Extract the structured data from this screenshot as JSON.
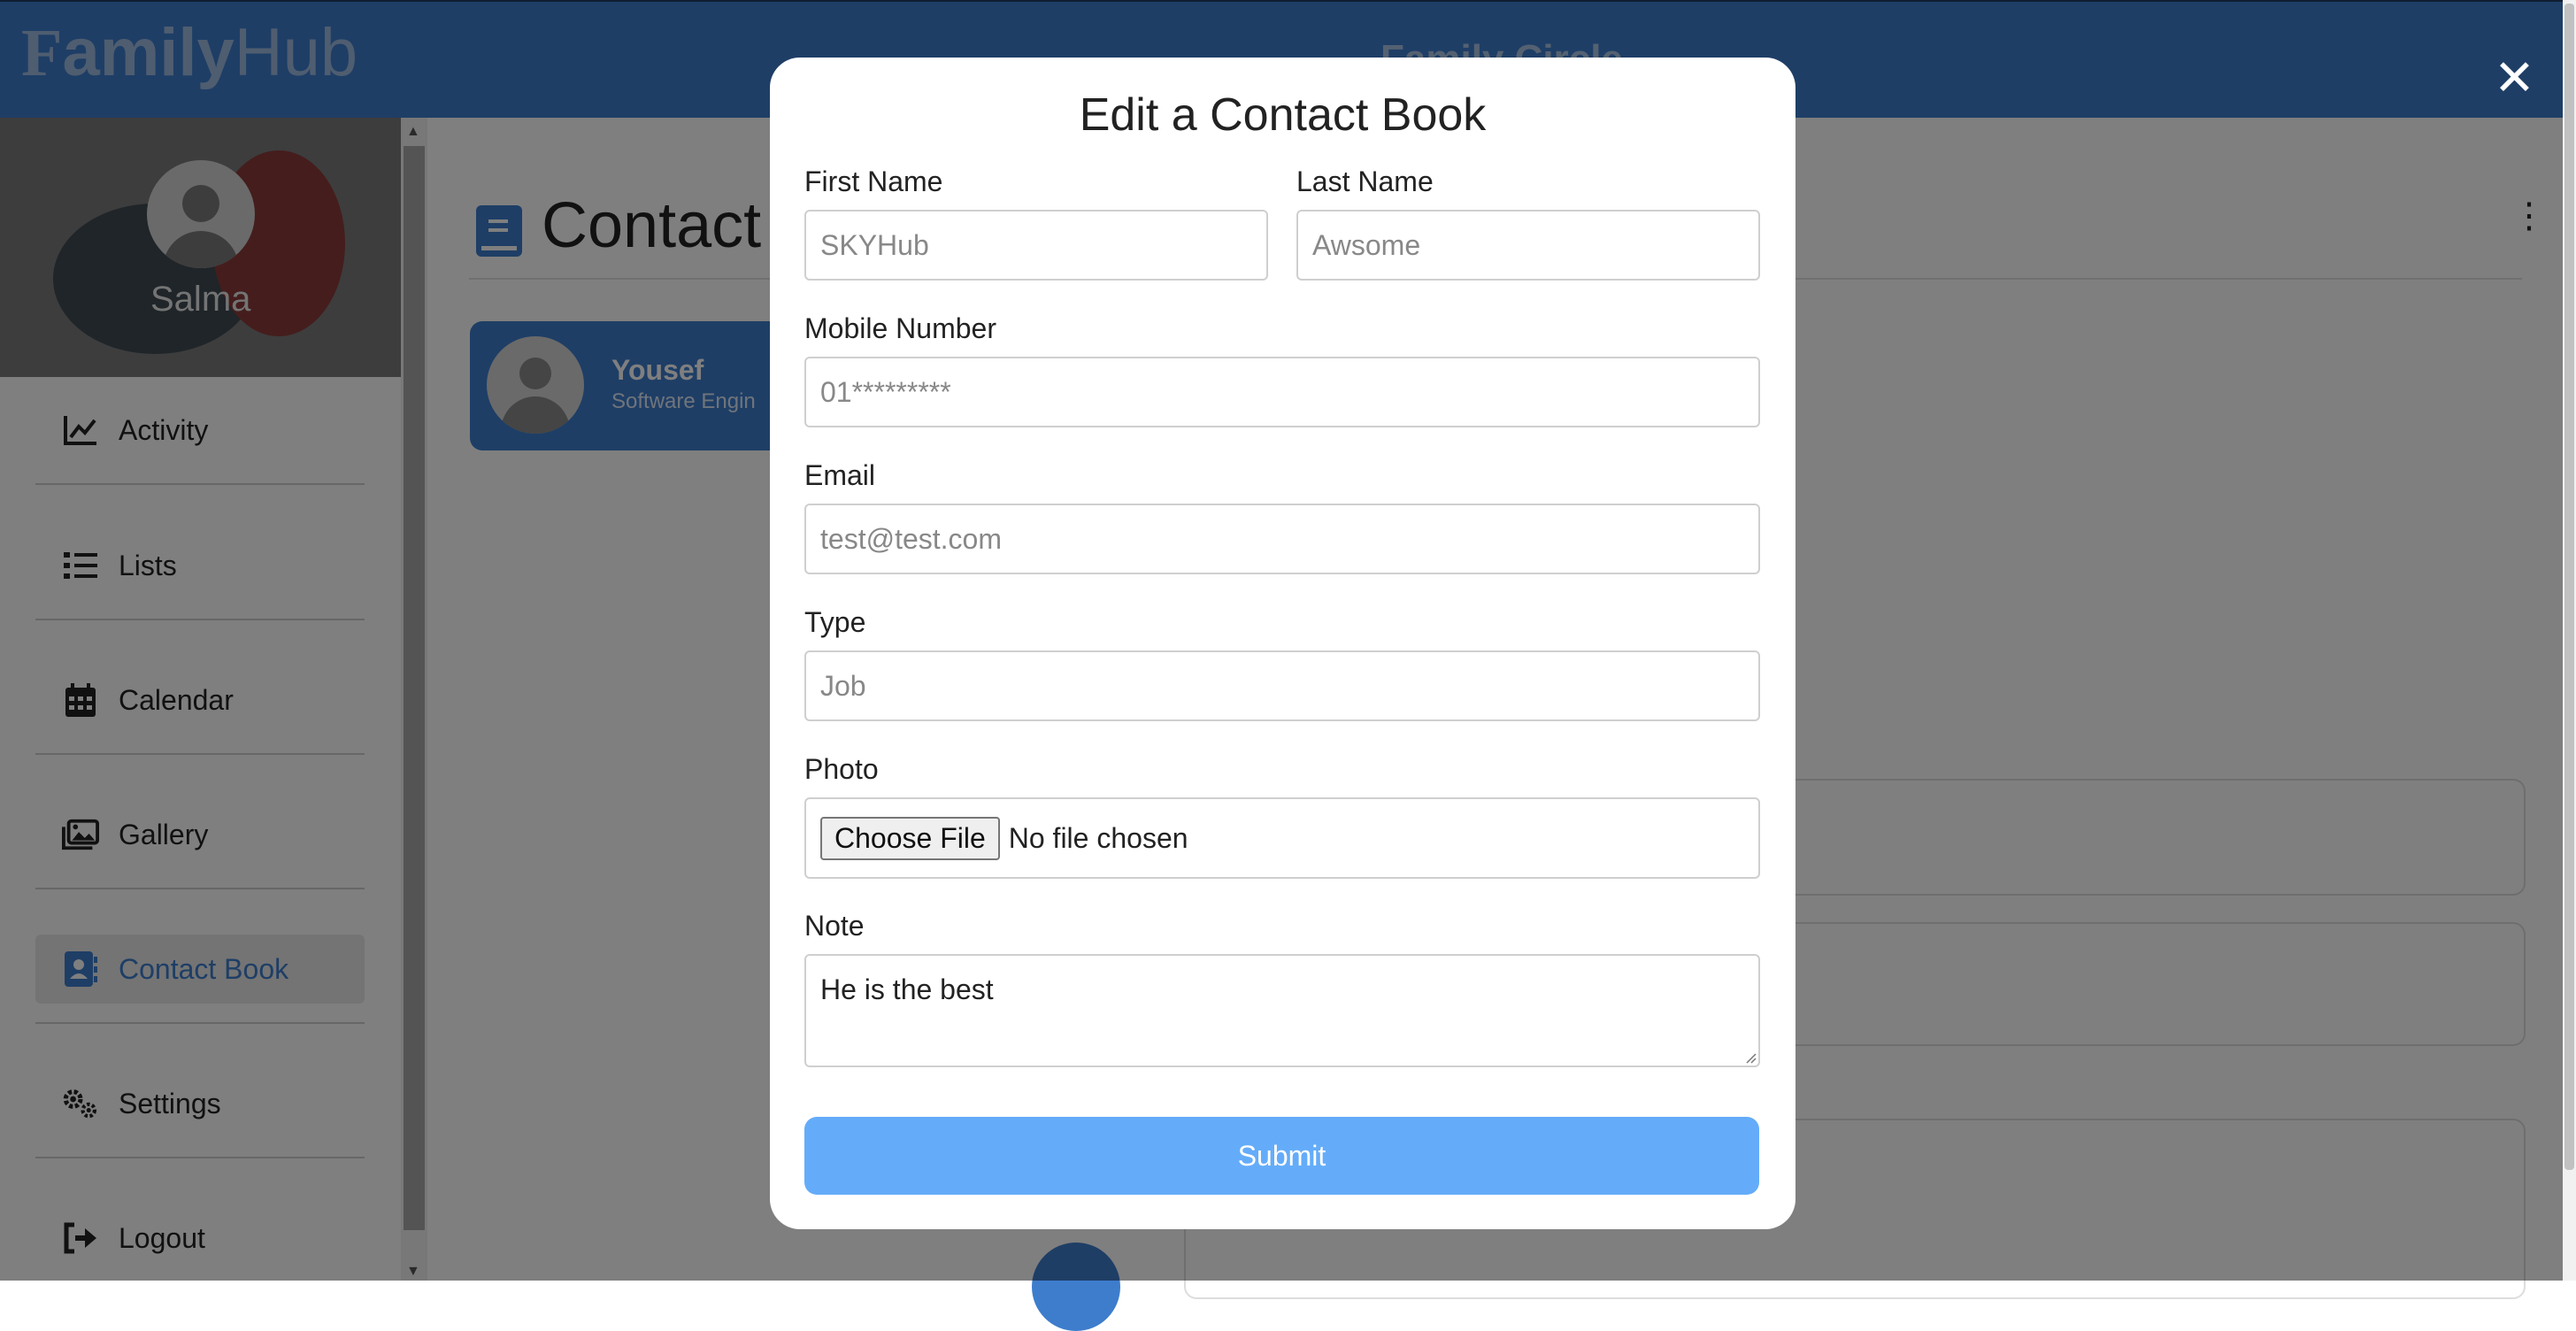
{
  "header": {
    "logo_bold": "F",
    "logo_mid": "amily",
    "logo_rest": "Hub",
    "title": "Family Circle",
    "close_glyph": "✕"
  },
  "sidebar": {
    "profile_name": "Salma",
    "items": [
      {
        "label": "Activity",
        "icon": "chart-line-icon",
        "active": false
      },
      {
        "label": "Lists",
        "icon": "list-icon",
        "active": false
      },
      {
        "label": "Calendar",
        "icon": "calendar-icon",
        "active": false
      },
      {
        "label": "Gallery",
        "icon": "images-icon",
        "active": false
      },
      {
        "label": "Contact Book",
        "icon": "address-book-icon",
        "active": true
      },
      {
        "label": "Settings",
        "icon": "gears-icon",
        "active": false
      },
      {
        "label": "Logout",
        "icon": "logout-icon",
        "active": false
      }
    ]
  },
  "main": {
    "page_title": "Contact",
    "menu_glyph": "⋮",
    "contact": {
      "name": "Yousef",
      "job": "Software Engin"
    }
  },
  "modal": {
    "title": "Edit a Contact Book",
    "first_name_label": "First Name",
    "first_name_placeholder": "SKYHub",
    "last_name_label": "Last Name",
    "last_name_placeholder": "Awsome",
    "mobile_label": "Mobile Number",
    "mobile_placeholder": "01*********",
    "email_label": "Email",
    "email_placeholder": "test@test.com",
    "type_label": "Type",
    "type_placeholder": "Job",
    "photo_label": "Photo",
    "choose_file": "Choose File",
    "no_file": "No file chosen",
    "note_label": "Note",
    "note_value": "He is the best",
    "submit_label": "Submit"
  },
  "colors": {
    "primary": "#3d7dcc",
    "submit": "#64acf9"
  }
}
